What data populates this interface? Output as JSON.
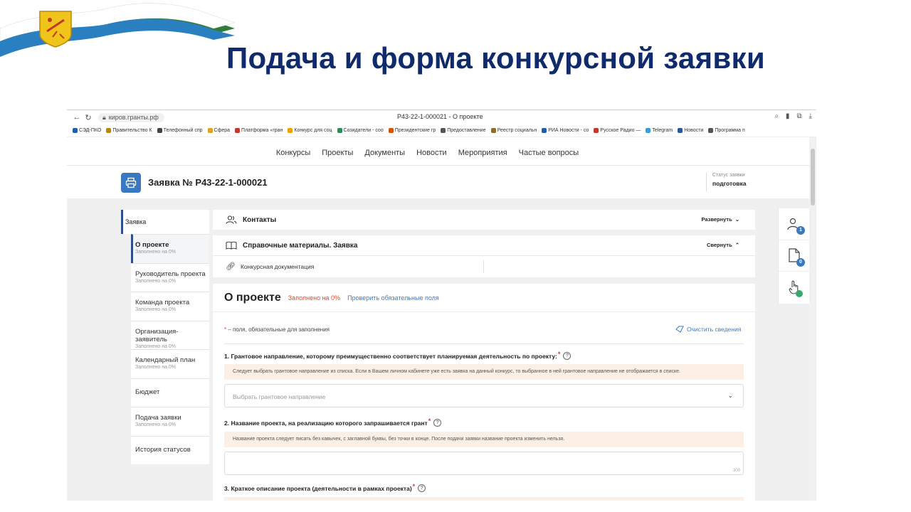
{
  "slide": {
    "title": "Подача и форма конкурсной заявки"
  },
  "browser": {
    "url": "киров.гранты.рф",
    "tab_title": "Р43-22-1-000021 - О проекте",
    "bookmarks": [
      {
        "label": "СЭД-ПКО",
        "color": "#1e5fa8"
      },
      {
        "label": "Правительство К",
        "color": "#b8860b"
      },
      {
        "label": "Телефонный спр",
        "color": "#444444"
      },
      {
        "label": "Сфера",
        "color": "#e0a020"
      },
      {
        "label": "Платформа «гран",
        "color": "#c0392b"
      },
      {
        "label": "Конкурс для соц",
        "color": "#f0a000"
      },
      {
        "label": "Созидатели - соо",
        "color": "#2e8b57"
      },
      {
        "label": "Президентские гр",
        "color": "#d35400"
      },
      {
        "label": "Предоставление",
        "color": "#555555"
      },
      {
        "label": "Реестр социальн",
        "color": "#8e6b2e"
      },
      {
        "label": "РИА Новости - со",
        "color": "#1e5fa8"
      },
      {
        "label": "Русское Радио —",
        "color": "#c0392b"
      },
      {
        "label": "Telegram",
        "color": "#2aa3df"
      },
      {
        "label": "Новости",
        "color": "#2b5797"
      },
      {
        "label": "Программа п",
        "color": "#555555"
      }
    ]
  },
  "site_nav": {
    "items": [
      "Конкурсы",
      "Проекты",
      "Документы",
      "Новости",
      "Мероприятия",
      "Частые вопросы"
    ]
  },
  "app_header": {
    "title": "Заявка № Р43-22-1-000021",
    "status_label": "Статус заявки",
    "status_value": "подготовка"
  },
  "sidebar": {
    "top_label": "Заявка",
    "items": [
      {
        "label": "О проекте",
        "fill": "Заполнено на 0%"
      },
      {
        "label": "Руководитель проекта",
        "fill": "Заполнено на 0%"
      },
      {
        "label": "Команда проекта",
        "fill": "Заполнено на 0%"
      },
      {
        "label": "Организация-заявитель",
        "fill": "Заполнено на 0%"
      },
      {
        "label": "Календарный план",
        "fill": "Заполнено на 0%"
      },
      {
        "label": "Бюджет",
        "fill": ""
      },
      {
        "label": "Подача заявки",
        "fill": "Заполнено на 0%"
      },
      {
        "label": "История статусов",
        "fill": ""
      }
    ]
  },
  "accordions": {
    "contacts": {
      "title": "Контакты",
      "toggle": "Развернуть"
    },
    "reference": {
      "title": "Справочные материалы. Заявка",
      "toggle": "Свернуть",
      "row": "Конкурсная документация"
    }
  },
  "form": {
    "title": "О проекте",
    "fill_status": "Заполнено на 0%",
    "check_link": "Проверить обязательные поля",
    "required_note": "– поля, обязательные для заполнения",
    "required_star": "*",
    "clear_button": "Очистить сведения",
    "q1": {
      "label": "1. Грантовое направление, которому преимущественно соответствует планируемая деятельность по проекту:",
      "hint": "Следует выбрать грантовое направление из списка. Если в Вашем личном кабинете уже есть заявка на данный конкурс, то выбранное в ней грантовое направление не отображается в списке.",
      "placeholder": "Выбрать грантовое направление"
    },
    "q2": {
      "label": "2. Название проекта, на реализацию которого запрашивается грант",
      "hint": "Название проекта следует писать без кавычек, с заглавной буквы, без точки в конце. После подачи заявки название проекта изменить нельзя.",
      "counter": "300"
    },
    "q3": {
      "label": "3. Краткое описание проекта (деятельности в рамках проекта)"
    }
  },
  "rail": {
    "contacts_badge": "1",
    "docs_badge": "0"
  }
}
